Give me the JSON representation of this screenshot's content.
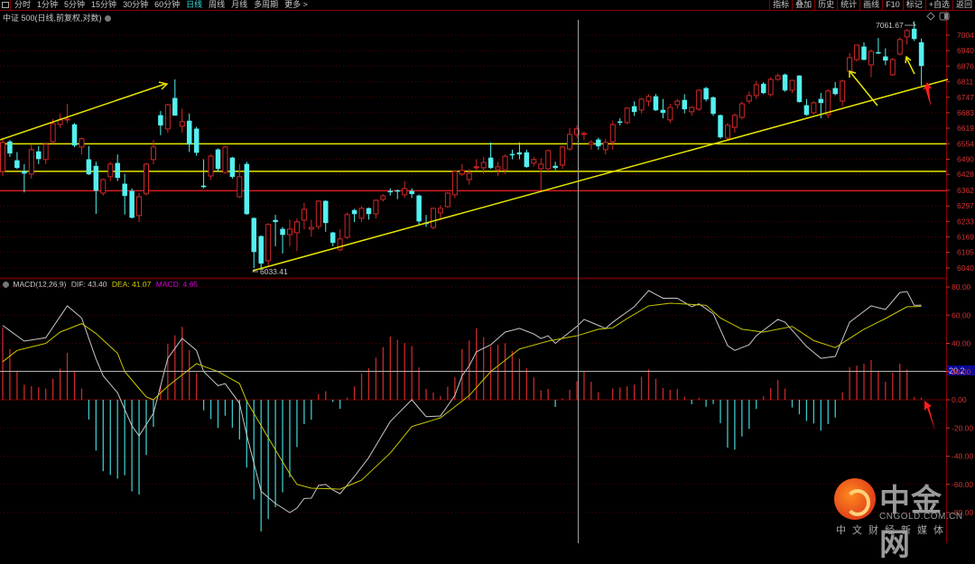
{
  "toolbar": {
    "periods": [
      "分时",
      "1分钟",
      "5分钟",
      "15分钟",
      "30分钟",
      "60分钟",
      "日线",
      "周线",
      "月线",
      "多周期",
      "更多 >"
    ],
    "active_period": "日线",
    "buttons": [
      "指标",
      "叠加",
      "历史",
      "统计",
      "画线",
      "F10",
      "标记",
      "+自选",
      "返回"
    ]
  },
  "chart_title": "中证 500(日线,前复权,对数)",
  "macd_legend": {
    "name": "MACD(12,26,9)",
    "dif": "DIF: 43.40",
    "dea": "DEA: 41.07",
    "macd": "MACD: 4.65"
  },
  "colors": {
    "up": "#d22828",
    "down": "#54f0f0",
    "dif": "#c8c8c8",
    "dea": "#c8c800",
    "grid": "#5a0000",
    "axis": "#d23232",
    "trend": "#e6e600"
  },
  "chart_data": [
    {
      "type": "candlestick",
      "title": "中证 500(日线,前复权,对数)",
      "y_ticks": [
        7004,
        6940,
        6876,
        6811,
        6747,
        6683,
        6619,
        6554,
        6490,
        6428,
        6362,
        6297,
        6233,
        6169,
        6105,
        6040
      ],
      "ylim": [
        6040,
        7004
      ],
      "annotations": {
        "high_label": "7061.67",
        "low_label": "6033.41"
      },
      "horizontal_levels": [
        {
          "price": 6554,
          "color": "#e6e600"
        },
        {
          "price": 6440,
          "color": "#e6e600"
        },
        {
          "price": 6360,
          "color": "#d21e1e"
        }
      ],
      "candles_ohlc": [
        [
          6440,
          6580,
          6420,
          6560
        ],
        [
          6563,
          6570,
          6500,
          6515
        ],
        [
          6485,
          6520,
          6450,
          6455
        ],
        [
          6440,
          6470,
          6353,
          6432
        ],
        [
          6429,
          6550,
          6410,
          6530
        ],
        [
          6522,
          6545,
          6470,
          6492
        ],
        [
          6489,
          6560,
          6470,
          6552
        ],
        [
          6563,
          6657,
          6555,
          6638
        ],
        [
          6634,
          6680,
          6620,
          6653
        ],
        [
          6653,
          6720,
          6640,
          6657
        ],
        [
          6634,
          6640,
          6540,
          6548
        ],
        [
          6541,
          6580,
          6510,
          6575
        ],
        [
          6489,
          6545,
          6425,
          6429
        ],
        [
          6462,
          6480,
          6264,
          6361
        ],
        [
          6350,
          6410,
          6340,
          6406
        ],
        [
          6418,
          6480,
          6400,
          6470
        ],
        [
          6474,
          6510,
          6400,
          6414
        ],
        [
          6388,
          6430,
          6261,
          6339
        ],
        [
          6358,
          6370,
          6245,
          6249
        ],
        [
          6257,
          6350,
          6230,
          6335
        ],
        [
          6347,
          6475,
          6340,
          6470
        ],
        [
          6489,
          6570,
          6470,
          6541
        ],
        [
          6672,
          6690,
          6590,
          6631
        ],
        [
          6616,
          6720,
          6600,
          6716
        ],
        [
          6743,
          6821,
          6670,
          6672
        ],
        [
          6627,
          6700,
          6600,
          6646
        ],
        [
          6649,
          6680,
          6520,
          6552
        ],
        [
          6616,
          6625,
          6505,
          6518
        ],
        [
          6380,
          6490,
          6370,
          6376
        ],
        [
          6421,
          6510,
          6405,
          6503
        ],
        [
          6530,
          6535,
          6440,
          6451
        ],
        [
          6436,
          6545,
          6430,
          6541
        ],
        [
          6496,
          6500,
          6410,
          6418
        ],
        [
          6335,
          6470,
          6330,
          6418
        ],
        [
          6470,
          6480,
          6260,
          6264
        ],
        [
          6246,
          6250,
          6040,
          6107
        ],
        [
          6171,
          6175,
          6033,
          6059
        ],
        [
          6070,
          6225,
          6050,
          6220
        ],
        [
          6238,
          6260,
          6130,
          6231
        ],
        [
          6201,
          6210,
          6100,
          6178
        ],
        [
          6178,
          6240,
          6130,
          6201
        ],
        [
          6186,
          6245,
          6110,
          6231
        ],
        [
          6238,
          6310,
          6200,
          6283
        ],
        [
          6201,
          6240,
          6170,
          6208
        ],
        [
          6212,
          6320,
          6200,
          6317
        ],
        [
          6317,
          6320,
          6190,
          6227
        ],
        [
          6186,
          6190,
          6130,
          6145
        ],
        [
          6115,
          6200,
          6110,
          6160
        ],
        [
          6167,
          6270,
          6160,
          6261
        ],
        [
          6279,
          6285,
          6230,
          6264
        ],
        [
          6246,
          6295,
          6230,
          6287
        ],
        [
          6287,
          6290,
          6240,
          6264
        ],
        [
          6264,
          6325,
          6245,
          6320
        ],
        [
          6324,
          6345,
          6315,
          6339
        ],
        [
          6358,
          6370,
          6340,
          6355
        ],
        [
          6361,
          6365,
          6325,
          6358
        ],
        [
          6343,
          6400,
          6330,
          6369
        ],
        [
          6358,
          6370,
          6330,
          6347
        ],
        [
          6339,
          6345,
          6220,
          6234
        ],
        [
          6227,
          6260,
          6210,
          6224
        ],
        [
          6208,
          6290,
          6200,
          6287
        ],
        [
          6268,
          6300,
          6240,
          6287
        ],
        [
          6294,
          6355,
          6290,
          6350
        ],
        [
          6343,
          6445,
          6330,
          6440
        ],
        [
          6429,
          6470,
          6420,
          6444
        ],
        [
          6406,
          6450,
          6385,
          6432
        ],
        [
          6455,
          6490,
          6445,
          6459
        ],
        [
          6455,
          6500,
          6430,
          6477
        ],
        [
          6496,
          6560,
          6450,
          6455
        ],
        [
          6447,
          6480,
          6420,
          6459
        ],
        [
          6447,
          6510,
          6430,
          6503
        ],
        [
          6511,
          6530,
          6490,
          6509
        ],
        [
          6518,
          6560,
          6490,
          6511
        ],
        [
          6518,
          6530,
          6455,
          6459
        ],
        [
          6474,
          6500,
          6460,
          6489
        ],
        [
          6451,
          6495,
          6362,
          6470
        ],
        [
          6451,
          6530,
          6440,
          6526
        ],
        [
          6462,
          6480,
          6445,
          6455
        ],
        [
          6466,
          6545,
          6450,
          6541
        ],
        [
          6533,
          6620,
          6525,
          6593
        ],
        [
          6593,
          6630,
          6580,
          6616
        ],
        [
          6593,
          6605,
          6570,
          6597
        ],
        [
          6552,
          6570,
          6530,
          6560
        ],
        [
          6571,
          6580,
          6530,
          6545
        ],
        [
          6530,
          6575,
          6510,
          6560
        ],
        [
          6563,
          6650,
          6530,
          6634
        ],
        [
          6646,
          6660,
          6630,
          6643
        ],
        [
          6642,
          6705,
          6635,
          6702
        ],
        [
          6709,
          6730,
          6670,
          6687
        ],
        [
          6694,
          6745,
          6680,
          6739
        ],
        [
          6731,
          6760,
          6710,
          6750
        ],
        [
          6750,
          6760,
          6690,
          6694
        ],
        [
          6694,
          6740,
          6660,
          6683
        ],
        [
          6653,
          6720,
          6640,
          6705
        ],
        [
          6716,
          6740,
          6700,
          6731
        ],
        [
          6735,
          6760,
          6680,
          6698
        ],
        [
          6687,
          6710,
          6670,
          6705
        ],
        [
          6698,
          6780,
          6690,
          6776
        ],
        [
          6784,
          6790,
          6730,
          6739
        ],
        [
          6746,
          6750,
          6670,
          6679
        ],
        [
          6672,
          6675,
          6575,
          6582
        ],
        [
          6578,
          6640,
          6570,
          6631
        ],
        [
          6623,
          6680,
          6600,
          6672
        ],
        [
          6664,
          6730,
          6655,
          6720
        ],
        [
          6731,
          6770,
          6720,
          6754
        ],
        [
          6754,
          6815,
          6740,
          6799
        ],
        [
          6802,
          6810,
          6760,
          6765
        ],
        [
          6758,
          6830,
          6750,
          6821
        ],
        [
          6821,
          6845,
          6815,
          6836
        ],
        [
          6840,
          6845,
          6770,
          6776
        ],
        [
          6776,
          6820,
          6765,
          6817
        ],
        [
          6836,
          6838,
          6725,
          6728
        ],
        [
          6713,
          6740,
          6670,
          6675
        ],
        [
          6683,
          6730,
          6675,
          6724
        ],
        [
          6739,
          6765,
          6660,
          6724
        ],
        [
          6675,
          6780,
          6660,
          6773
        ],
        [
          6784,
          6810,
          6755,
          6761
        ],
        [
          6731,
          6820,
          6710,
          6814
        ],
        [
          6855,
          6930,
          6840,
          6911
        ],
        [
          6903,
          6965,
          6895,
          6963
        ],
        [
          6956,
          6975,
          6900,
          6903
        ],
        [
          6881,
          6945,
          6830,
          6937
        ],
        [
          6933,
          6993,
          6925,
          6930
        ],
        [
          6915,
          6950,
          6880,
          6900
        ],
        [
          6840,
          6910,
          6835,
          6903
        ],
        [
          6926,
          6995,
          6920,
          6986
        ],
        [
          6997,
          7030,
          6965,
          7023
        ],
        [
          7030,
          7062,
          6980,
          6989
        ],
        [
          6974,
          6990,
          6795,
          6877
        ]
      ]
    },
    {
      "type": "line+bar",
      "title": "MACD(12,26,9)",
      "y_ticks": [
        "80.00",
        "60.00",
        "40.00",
        "20.00",
        "0.00",
        "-20.00",
        "-40.00",
        "-60.00",
        "-80.00"
      ],
      "ylim": [
        -80,
        80
      ],
      "cursor_value": "20.2",
      "histogram_rule": "2*(DIF-DEA)",
      "dif_points": [
        [
          0,
          52.7
        ],
        [
          3,
          41.6
        ],
        [
          6,
          44
        ],
        [
          9,
          66.6
        ],
        [
          11,
          58
        ],
        [
          13,
          29
        ],
        [
          14,
          17
        ],
        [
          16,
          5
        ],
        [
          18,
          -18.5
        ],
        [
          19,
          -25.6
        ],
        [
          21,
          -9.6
        ],
        [
          23,
          29.4
        ],
        [
          25,
          43.5
        ],
        [
          27,
          35
        ],
        [
          28,
          20
        ],
        [
          30,
          10
        ],
        [
          31,
          11.5
        ],
        [
          33,
          -2.6
        ],
        [
          34,
          -25
        ],
        [
          36,
          -65
        ],
        [
          38,
          -73.6
        ],
        [
          40,
          -80
        ],
        [
          41,
          -76.8
        ],
        [
          42,
          -70
        ],
        [
          43,
          -69.8
        ],
        [
          44,
          -60.8
        ],
        [
          45,
          -60
        ],
        [
          46,
          -64
        ],
        [
          47,
          -66.6
        ],
        [
          49,
          -54.4
        ],
        [
          51,
          -41
        ],
        [
          54,
          -15.4
        ],
        [
          57,
          0
        ],
        [
          59,
          -12
        ],
        [
          61,
          -11.5
        ],
        [
          63,
          3
        ],
        [
          64,
          17
        ],
        [
          65,
          24
        ],
        [
          66,
          34
        ],
        [
          68,
          39
        ],
        [
          70,
          48
        ],
        [
          72,
          50.6
        ],
        [
          74,
          46.7
        ],
        [
          75,
          43.5
        ],
        [
          76,
          45.4
        ],
        [
          77,
          40
        ],
        [
          80,
          52
        ],
        [
          81,
          57
        ],
        [
          84,
          50.6
        ],
        [
          85,
          55
        ],
        [
          88,
          66
        ],
        [
          90,
          77.4
        ],
        [
          92,
          72
        ],
        [
          94,
          72
        ],
        [
          96,
          66
        ],
        [
          97,
          68
        ],
        [
          99,
          61
        ],
        [
          101,
          38.4
        ],
        [
          102,
          35
        ],
        [
          104,
          39
        ],
        [
          105,
          45.4
        ],
        [
          108,
          57
        ],
        [
          109,
          55
        ],
        [
          112,
          37.8
        ],
        [
          114,
          29.4
        ],
        [
          116,
          30.7
        ],
        [
          118,
          55
        ],
        [
          121,
          66.6
        ],
        [
          123,
          64
        ],
        [
          125,
          76
        ],
        [
          126,
          76.8
        ],
        [
          127,
          67
        ]
      ],
      "dea_points": [
        [
          0,
          27
        ],
        [
          2,
          35
        ],
        [
          6,
          40
        ],
        [
          8,
          48
        ],
        [
          11,
          54
        ],
        [
          13,
          47
        ],
        [
          16,
          33
        ],
        [
          17,
          20
        ],
        [
          20,
          2
        ],
        [
          21,
          0
        ],
        [
          23,
          9.6
        ],
        [
          27,
          25.6
        ],
        [
          30,
          20
        ],
        [
          33,
          11.5
        ],
        [
          34,
          -1
        ],
        [
          37,
          -27
        ],
        [
          40,
          -52.5
        ],
        [
          41,
          -60
        ],
        [
          43,
          -62.7
        ],
        [
          47,
          -63.4
        ],
        [
          50,
          -57
        ],
        [
          54,
          -37.8
        ],
        [
          57,
          -19
        ],
        [
          61,
          -12.8
        ],
        [
          64,
          -1
        ],
        [
          65,
          3
        ],
        [
          68,
          20
        ],
        [
          72,
          36
        ],
        [
          76,
          41.6
        ],
        [
          80,
          45.4
        ],
        [
          83,
          50
        ],
        [
          85,
          51
        ],
        [
          87,
          57.6
        ],
        [
          90,
          66.6
        ],
        [
          93,
          68.5
        ],
        [
          98,
          67
        ],
        [
          100,
          58
        ],
        [
          103,
          50
        ],
        [
          106,
          48
        ],
        [
          110,
          52
        ],
        [
          113,
          42
        ],
        [
          116,
          37
        ],
        [
          120,
          50
        ],
        [
          123,
          57.6
        ],
        [
          126,
          66
        ],
        [
          127,
          66
        ]
      ]
    }
  ],
  "logo": {
    "name": "中金网",
    "url": "CNGOLD.COM.CN",
    "tagline": "中文财经新媒体"
  }
}
